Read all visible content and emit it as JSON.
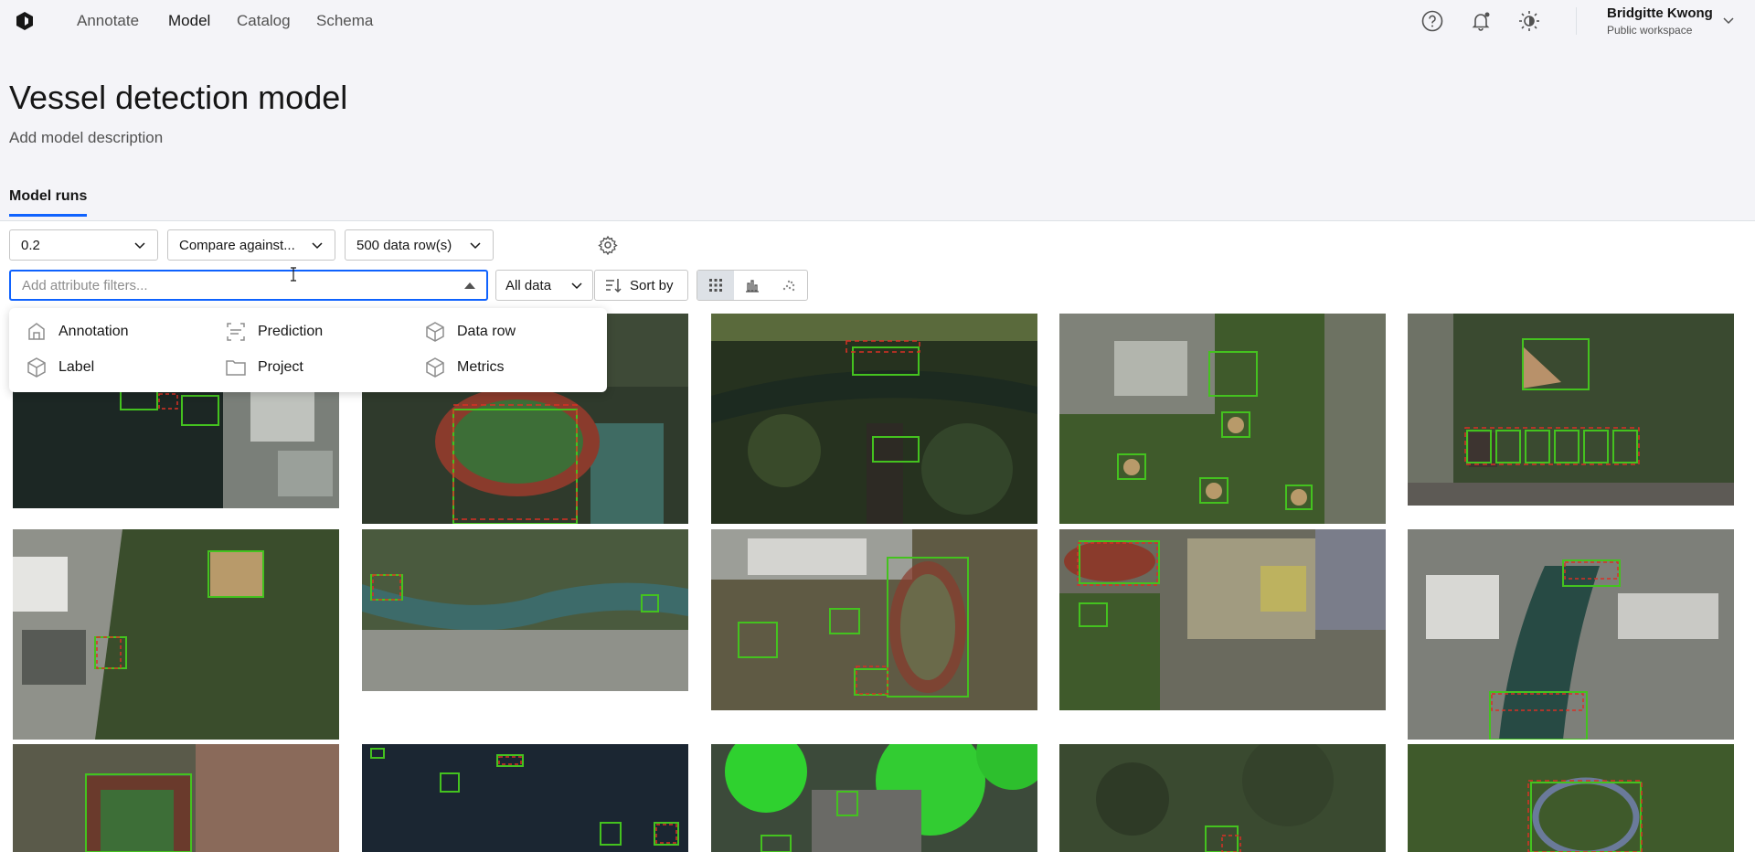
{
  "nav": {
    "links": [
      "Annotate",
      "Model",
      "Catalog",
      "Schema"
    ],
    "active": "Model",
    "user_name": "Bridgitte Kwong",
    "workspace": "Public workspace"
  },
  "header": {
    "title": "Vessel detection model",
    "description": "Add model description",
    "tab": "Model runs"
  },
  "toolbar": {
    "version": "0.2",
    "compare": "Compare against...",
    "rows": "500 data row(s)",
    "filter_placeholder": "Add attribute filters...",
    "scope": "All data",
    "sort": "Sort by"
  },
  "filter_menu": {
    "items": [
      "Annotation",
      "Prediction",
      "Data row",
      "Label",
      "Project",
      "Metrics"
    ]
  },
  "icons": [
    "logo-icon",
    "help-icon",
    "notification-icon",
    "theme-icon",
    "chevron-down-icon",
    "gear-icon",
    "sort-icon",
    "grid-view-icon",
    "chart-view-icon",
    "scatter-view-icon"
  ],
  "colors": {
    "accent": "#0f62fe",
    "label_box": "#4caf28",
    "prediction_box": "#d93025"
  }
}
